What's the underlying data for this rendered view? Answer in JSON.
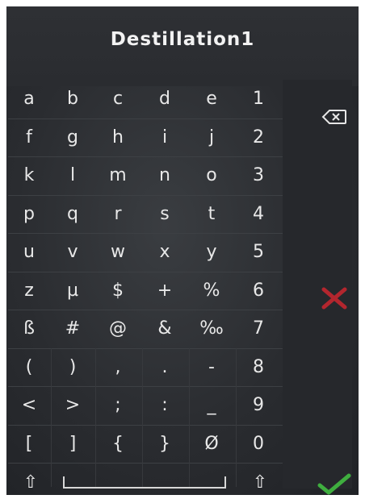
{
  "header": {
    "title": "Destillation1"
  },
  "keys": {
    "rows": [
      [
        "a",
        "b",
        "c",
        "d",
        "e",
        "1"
      ],
      [
        "f",
        "g",
        "h",
        "i",
        "j",
        "2"
      ],
      [
        "k",
        "l",
        "m",
        "n",
        "o",
        "3"
      ],
      [
        "p",
        "q",
        "r",
        "s",
        "t",
        "4"
      ],
      [
        "u",
        "v",
        "w",
        "x",
        "y",
        "5"
      ],
      [
        "z",
        "µ",
        "$",
        "+",
        "%",
        "6"
      ],
      [
        "ß",
        "#",
        "@",
        "&",
        "‰",
        "7"
      ],
      [
        "(",
        ")",
        ",",
        ".",
        "-",
        "8"
      ],
      [
        "<",
        ">",
        ";",
        ":",
        "_",
        "9"
      ],
      [
        "[",
        "]",
        "{",
        "}",
        "Ø",
        "0"
      ]
    ],
    "shift_left": "⇧",
    "shift_right": "⇧"
  },
  "side": {
    "backspace_icon": "backspace-icon",
    "cancel_icon": "cancel-icon",
    "confirm_icon": "checkmark-icon",
    "cancel_color": "#b3262e",
    "confirm_color": "#3fae3f"
  }
}
